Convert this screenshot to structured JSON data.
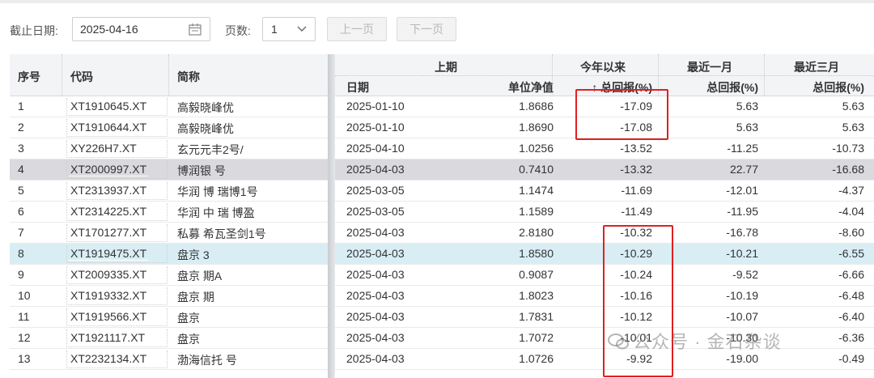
{
  "toolbar": {
    "date_label": "截止日期:",
    "date_value": "2025-04-16",
    "pages_label": "页数:",
    "page_value": "1",
    "prev_label": "上一页",
    "next_label": "下一页"
  },
  "table": {
    "headers": {
      "seq": "序号",
      "code": "代码",
      "name": "简称",
      "group_prev": "上期",
      "group_ytd": "今年以来",
      "group_1m": "最近一月",
      "group_3m": "最近三月",
      "date": "日期",
      "nav": "单位净值",
      "ytd": "↑ 总回报(%)",
      "ret1m": "总回报(%)",
      "ret3m": "总回报(%)"
    },
    "rows": [
      {
        "seq": "1",
        "code": "XT1910645.XT",
        "name": "高毅晓峰优",
        "cut": "3",
        "date": "2025-01-10",
        "nav": "1.8686",
        "ytd": "-17.09",
        "m1": "5.63",
        "m3": "5.63"
      },
      {
        "seq": "2",
        "code": "XT1910644.XT",
        "name": "高毅晓峰优",
        "cut": "3",
        "date": "2025-01-10",
        "nav": "1.8690",
        "ytd": "-17.08",
        "m1": "5.63",
        "m3": "5.63"
      },
      {
        "seq": "3",
        "code": "XY226H7.XT",
        "name": "玄元元丰2号/",
        "cut": "5",
        "date": "2025-04-10",
        "nav": "1.0256",
        "ytd": "-13.52",
        "m1": "-11.25",
        "m3": "-10.73"
      },
      {
        "seq": "4",
        "code": "XT2000997.XT",
        "name": "博润银     号",
        "cut": "7",
        "date": "2025-04-03",
        "nav": "0.7410",
        "ytd": "-13.32",
        "m1": "22.77",
        "m3": "-16.68"
      },
      {
        "seq": "5",
        "code": "XT2313937.XT",
        "name": "华润     博     瑞博1号",
        "cut": "1",
        "date": "2025-03-05",
        "nav": "1.1474",
        "ytd": "-11.69",
        "m1": "-12.01",
        "m3": "-4.37"
      },
      {
        "seq": "6",
        "code": "XT2314225.XT",
        "name": "华润     中     瑞     博盈",
        "cut": "5",
        "date": "2025-03-05",
        "nav": "1.1589",
        "ytd": "-11.49",
        "m1": "-11.95",
        "m3": "-4.04"
      },
      {
        "seq": "7",
        "code": "XT1701277.XT",
        "name": "私募     希瓦圣剑1号",
        "cut": "7",
        "date": "2025-04-03",
        "nav": "2.8180",
        "ytd": "-10.32",
        "m1": "-16.78",
        "m3": "-8.60"
      },
      {
        "seq": "8",
        "code": "XT1919475.XT",
        "name": "盘京     3",
        "cut": "0",
        "date": "2025-04-03",
        "nav": "1.8580",
        "ytd": "-10.29",
        "m1": "-10.21",
        "m3": "-6.55"
      },
      {
        "seq": "9",
        "code": "XT2009335.XT",
        "name": "盘京     期A",
        "cut": "5",
        "date": "2025-04-03",
        "nav": "0.9087",
        "ytd": "-10.24",
        "m1": "-9.52",
        "m3": "-6.66"
      },
      {
        "seq": "10",
        "code": "XT1919332.XT",
        "name": "盘京     期",
        "cut": "0",
        "date": "2025-04-03",
        "nav": "1.8023",
        "ytd": "-10.16",
        "m1": "-10.19",
        "m3": "-6.48"
      },
      {
        "seq": "11",
        "code": "XT1919566.XT",
        "name": "盘京",
        "cut": "0",
        "date": "2025-04-03",
        "nav": "1.7831",
        "ytd": "-10.12",
        "m1": "-10.07",
        "m3": "-6.40"
      },
      {
        "seq": "12",
        "code": "XT1921117.XT",
        "name": "盘京",
        "cut": "2",
        "date": "2025-04-03",
        "nav": "1.7072",
        "ytd": "-10.01",
        "m1": "-10.30",
        "m3": "-6.36"
      },
      {
        "seq": "13",
        "code": "XT2232134.XT",
        "name": "渤海信托     号",
        "cut": "3",
        "date": "2025-04-03",
        "nav": "1.0726",
        "ytd": "-9.92",
        "m1": "-19.00",
        "m3": "-0.49"
      }
    ]
  },
  "watermark": "公众号 · 金石杂谈",
  "colors": {
    "highlight_box": "#e02020",
    "selected_row": "#d8eef4",
    "hover_row": "#d9d9de",
    "header_bg": "#f3f4f6"
  }
}
